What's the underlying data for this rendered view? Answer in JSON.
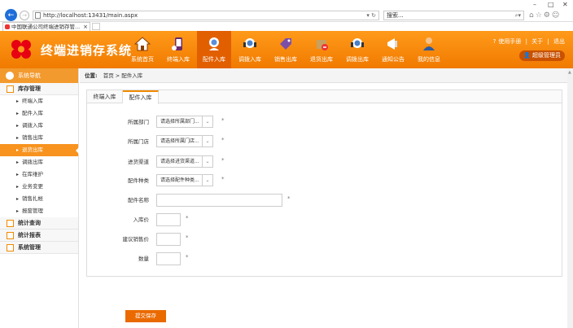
{
  "browser": {
    "url": "http://localhost:13431/main.aspx",
    "search_placeholder": "搜索...",
    "tab_title": "中国联通公司终端进销存管...",
    "minimize": "–",
    "maximize": "□",
    "close": "✕"
  },
  "header": {
    "system_title": "终端进销存系统",
    "nav": [
      {
        "label": "系统首页"
      },
      {
        "label": "终端入库"
      },
      {
        "label": "配件入库"
      },
      {
        "label": "调拨入库"
      },
      {
        "label": "销售出库"
      },
      {
        "label": "退货出库"
      },
      {
        "label": "调拨出库"
      },
      {
        "label": "通知公告"
      },
      {
        "label": "我的信息"
      }
    ],
    "manual": "使用手册",
    "about": "关于",
    "logout": "退出",
    "sep": "|",
    "user": "超级管理员"
  },
  "sidebar": {
    "title": "系统导航",
    "groups": [
      {
        "label": "库存管理"
      },
      {
        "label": "统计查询"
      },
      {
        "label": "统计报表"
      },
      {
        "label": "系统管理"
      }
    ],
    "items": [
      {
        "label": "终端入库"
      },
      {
        "label": "配件入库"
      },
      {
        "label": "调拨入库"
      },
      {
        "label": "销售出库"
      },
      {
        "label": "退货出库"
      },
      {
        "label": "调拨出库"
      },
      {
        "label": "在库维护"
      },
      {
        "label": "业务变更"
      },
      {
        "label": "销售扎帐"
      },
      {
        "label": "报废管理"
      }
    ]
  },
  "breadcrumb": {
    "prefix": "位置:",
    "home": "首页",
    "sep": ">",
    "current": "配件入库"
  },
  "tabs": [
    {
      "label": "终端入库"
    },
    {
      "label": "配件入库"
    }
  ],
  "form": {
    "dept_label": "所属部门",
    "dept_value": "请选择所属部门...",
    "store_label": "所属门店",
    "store_value": "请选择所属门店...",
    "channel_label": "进货渠道",
    "channel_value": "请选择进货渠道...",
    "type_label": "配件种类",
    "type_value": "请选择配件种类...",
    "name_label": "配件名称",
    "price_label": "入库价",
    "suggest_label": "建议销售价",
    "qty_label": "数量",
    "required_mark": "*",
    "submit": "提交保存"
  }
}
